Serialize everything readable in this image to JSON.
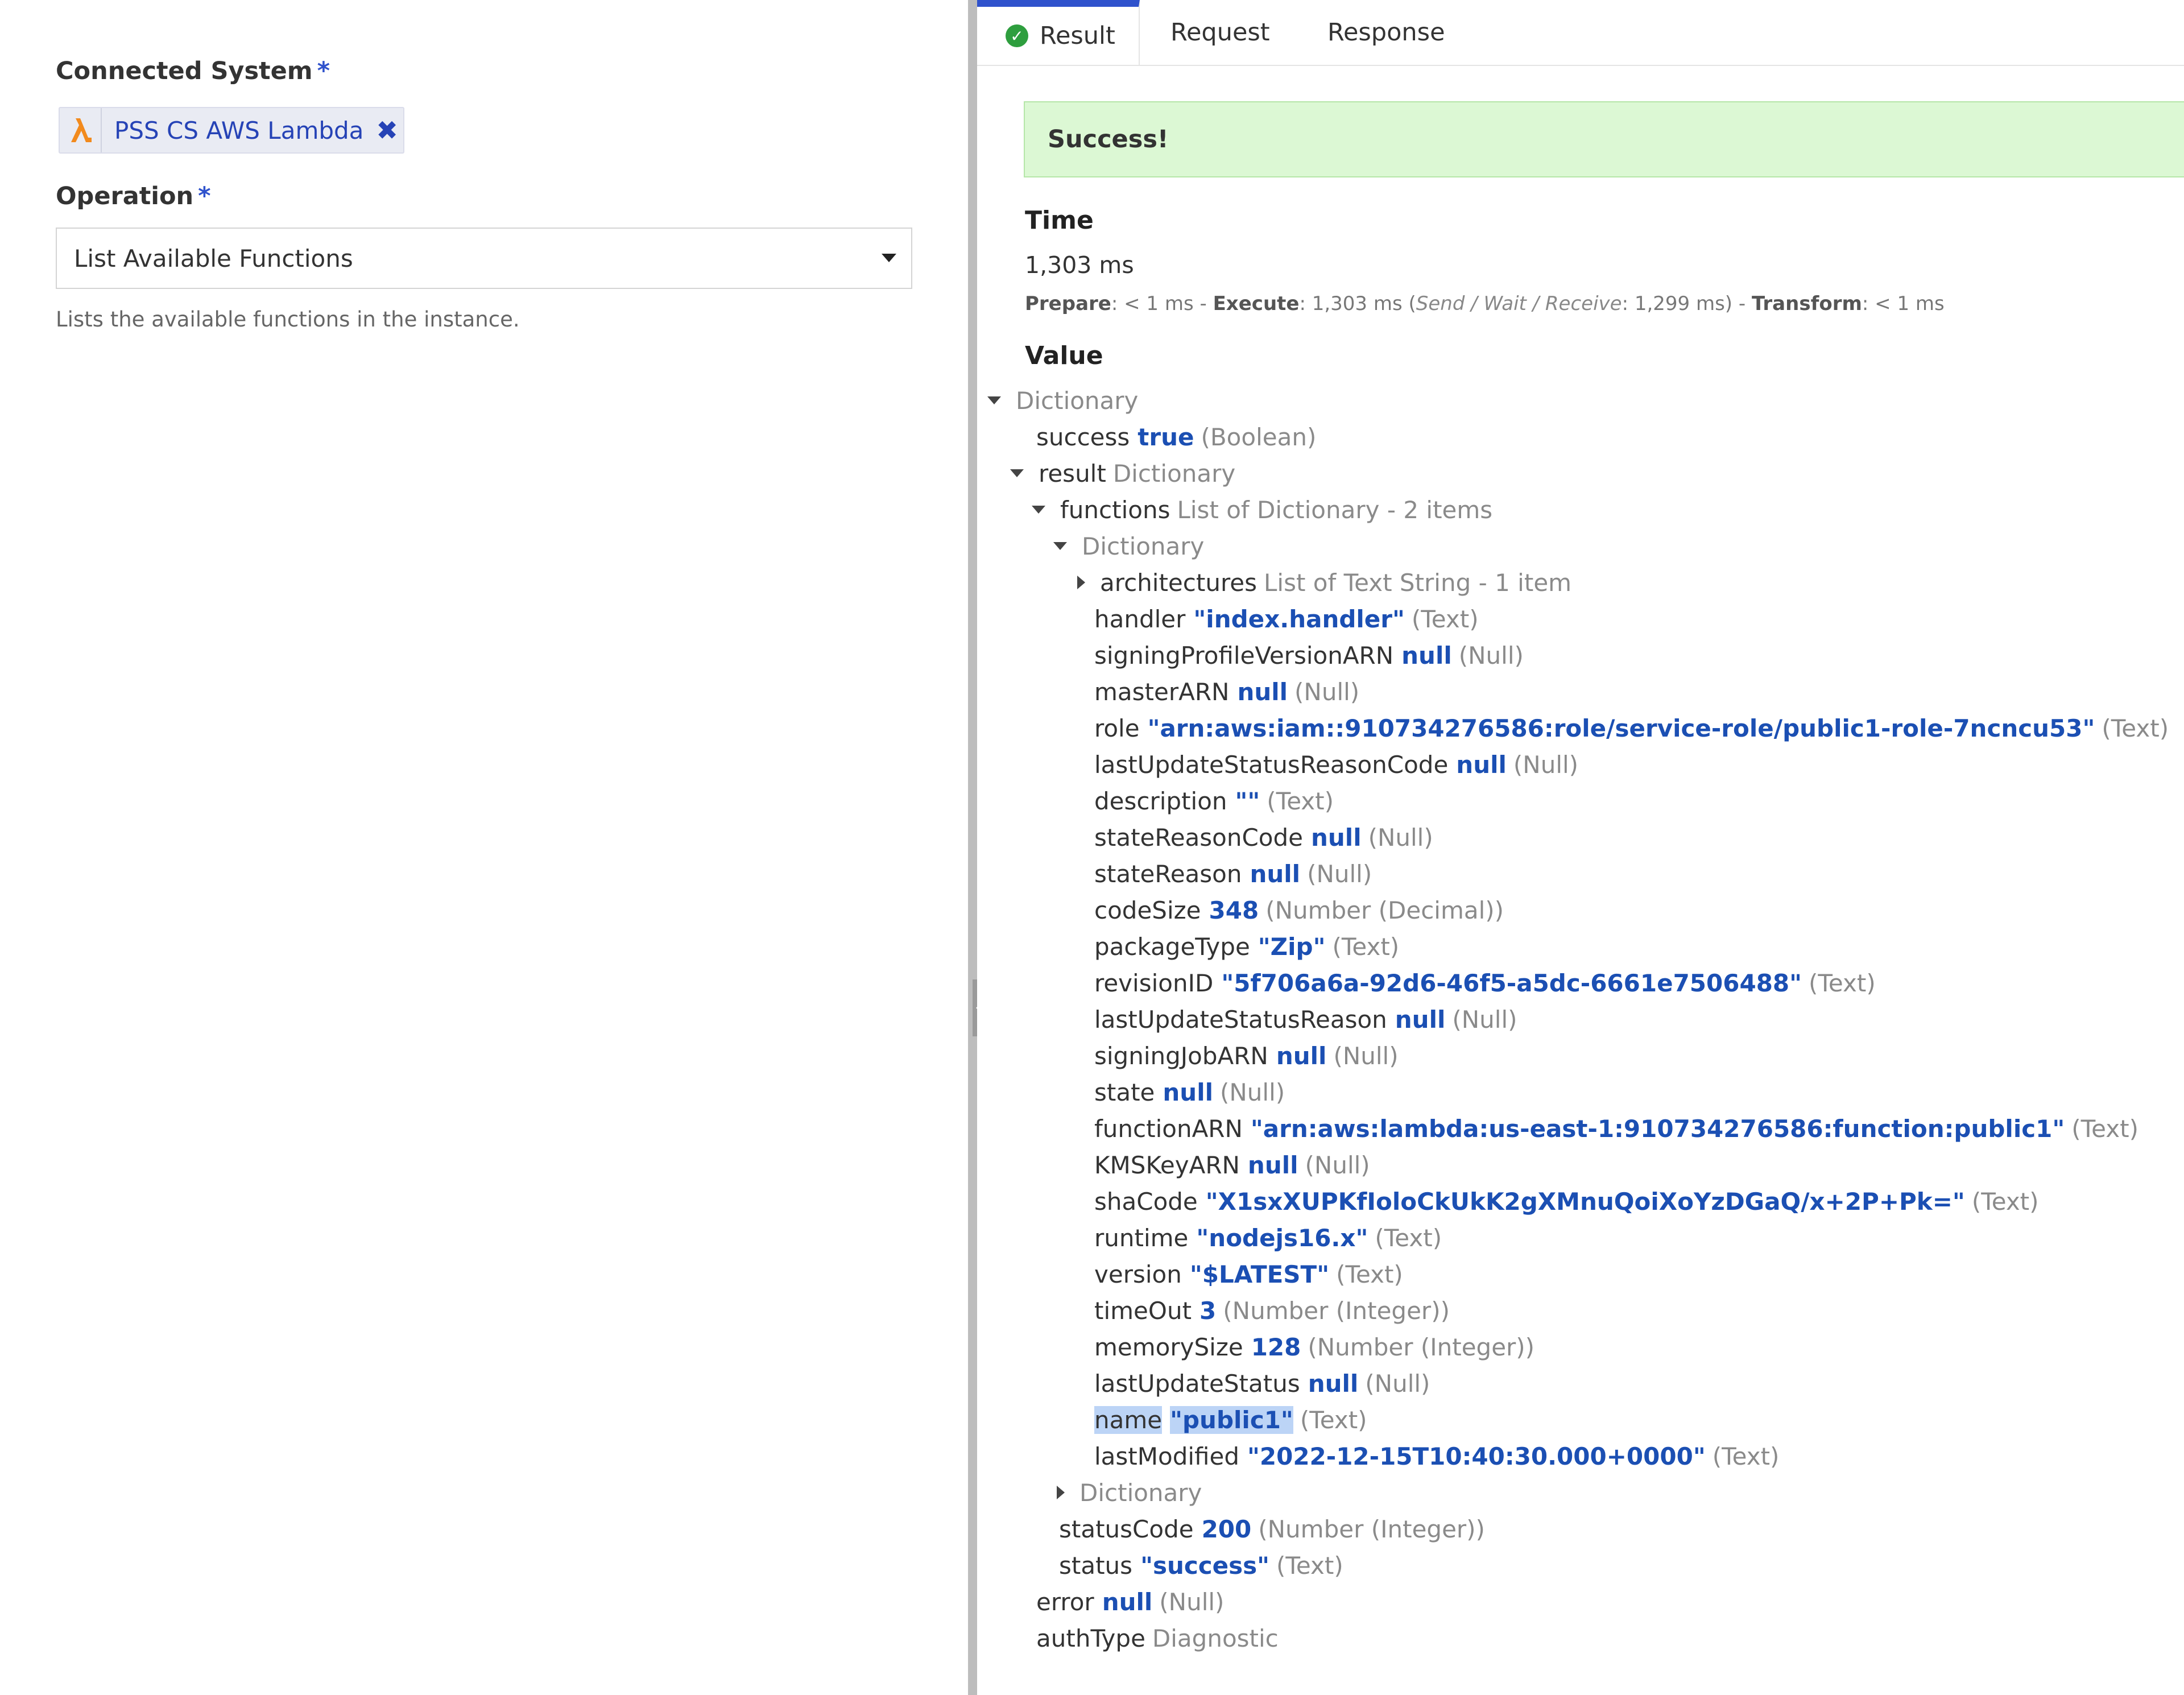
{
  "left": {
    "connected_system_label": "Connected System",
    "required_mark": "*",
    "system_chip_label": "PSS CS AWS Lambda",
    "system_chip_remove": "✖",
    "operation_label": "Operation",
    "operation_value": "List Available Functions",
    "operation_help": "Lists the available functions in the instance."
  },
  "tabs": [
    {
      "label": "Result",
      "active": true,
      "icon": "check-circle-icon"
    },
    {
      "label": "Request",
      "active": false
    },
    {
      "label": "Response",
      "active": false
    }
  ],
  "banner": {
    "text": "Success!",
    "color": "#dcf8d4"
  },
  "time": {
    "heading": "Time",
    "total": "1,303 ms",
    "prepare_label": "Prepare",
    "prepare_value": ": < 1 ms - ",
    "execute_label": "Execute",
    "execute_value": ": 1,303 ms (",
    "execute_breakdown_label": "Send / Wait / Receive",
    "execute_breakdown_value": ": 1,299 ms) - ",
    "transform_label": "Transform",
    "transform_value": ": < 1 ms"
  },
  "value_heading": "Value",
  "tree": [
    {
      "twisty": "down",
      "key": "",
      "value": "",
      "type": "Dictionary"
    },
    {
      "twisty": "",
      "key": "success",
      "value": "true",
      "type": "(Boolean)"
    },
    {
      "twisty": "down",
      "key": "result",
      "value": "",
      "type": "Dictionary"
    },
    {
      "twisty": "down",
      "key": "functions",
      "value": "",
      "type": "List of Dictionary - 2 items"
    },
    {
      "twisty": "down",
      "key": "",
      "value": "",
      "type": "Dictionary"
    },
    {
      "twisty": "right",
      "key": "architectures",
      "value": "",
      "type": "List of Text String - 1 item"
    },
    {
      "twisty": "",
      "key": "handler",
      "value": "\"index.handler\"",
      "type": "(Text)"
    },
    {
      "twisty": "",
      "key": "signingProfileVersionARN",
      "value": "null",
      "type": "(Null)"
    },
    {
      "twisty": "",
      "key": "masterARN",
      "value": "null",
      "type": "(Null)"
    },
    {
      "twisty": "",
      "key": "role",
      "value": "\"arn:aws:iam::910734276586:role/service-role/public1-role-7ncncu53\"",
      "type": "(Text)"
    },
    {
      "twisty": "",
      "key": "lastUpdateStatusReasonCode",
      "value": "null",
      "type": "(Null)"
    },
    {
      "twisty": "",
      "key": "description",
      "value": "\"\"",
      "type": "(Text)"
    },
    {
      "twisty": "",
      "key": "stateReasonCode",
      "value": "null",
      "type": "(Null)"
    },
    {
      "twisty": "",
      "key": "stateReason",
      "value": "null",
      "type": "(Null)"
    },
    {
      "twisty": "",
      "key": "codeSize",
      "value": "348",
      "type": "(Number (Decimal))"
    },
    {
      "twisty": "",
      "key": "packageType",
      "value": "\"Zip\"",
      "type": "(Text)"
    },
    {
      "twisty": "",
      "key": "revisionID",
      "value": "\"5f706a6a-92d6-46f5-a5dc-6661e7506488\"",
      "type": "(Text)"
    },
    {
      "twisty": "",
      "key": "lastUpdateStatusReason",
      "value": "null",
      "type": "(Null)"
    },
    {
      "twisty": "",
      "key": "signingJobARN",
      "value": "null",
      "type": "(Null)"
    },
    {
      "twisty": "",
      "key": "state",
      "value": "null",
      "type": "(Null)"
    },
    {
      "twisty": "",
      "key": "functionARN",
      "value": "\"arn:aws:lambda:us-east-1:910734276586:function:public1\"",
      "type": "(Text)"
    },
    {
      "twisty": "",
      "key": "KMSKeyARN",
      "value": "null",
      "type": "(Null)"
    },
    {
      "twisty": "",
      "key": "shaCode",
      "value": "\"X1sxXUPKfIoloCkUkK2gXMnuQoiXoYzDGaQ/x+2P+Pk=\"",
      "type": "(Text)"
    },
    {
      "twisty": "",
      "key": "runtime",
      "value": "\"nodejs16.x\"",
      "type": "(Text)"
    },
    {
      "twisty": "",
      "key": "version",
      "value": "\"$LATEST\"",
      "type": "(Text)"
    },
    {
      "twisty": "",
      "key": "timeOut",
      "value": "3",
      "type": "(Number (Integer))"
    },
    {
      "twisty": "",
      "key": "memorySize",
      "value": "128",
      "type": "(Number (Integer))"
    },
    {
      "twisty": "",
      "key": "lastUpdateStatus",
      "value": "null",
      "type": "(Null)"
    },
    {
      "twisty": "",
      "key": "name",
      "value": "\"public1\"",
      "type": "(Text)",
      "selected": true
    },
    {
      "twisty": "",
      "key": "lastModified",
      "value": "\"2022-12-15T10:40:30.000+0000\"",
      "type": "(Text)"
    },
    {
      "twisty": "right",
      "key": "",
      "value": "",
      "type": "Dictionary"
    },
    {
      "twisty": "",
      "key": "statusCode",
      "value": "200",
      "type": "(Number (Integer))"
    },
    {
      "twisty": "",
      "key": "status",
      "value": "\"success\"",
      "type": "(Text)"
    },
    {
      "twisty": "",
      "key": "error",
      "value": "null",
      "type": "(Null)"
    },
    {
      "twisty": "",
      "key": "authType",
      "value": "",
      "type": "Diagnostic"
    }
  ]
}
